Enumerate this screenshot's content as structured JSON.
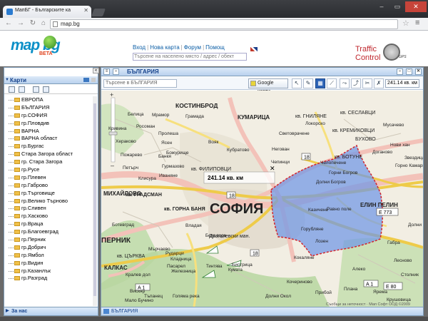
{
  "browser": {
    "tab_title": "МапБГ - Българските ка",
    "url": "map.bg"
  },
  "header": {
    "nav": [
      "Вход",
      "Нова карта",
      "Форум",
      "Помощ"
    ],
    "search_placeholder": "Търсене на населено място / адрес / обект",
    "logo_text": "map bg",
    "logo_beta": "BETA",
    "traffic_line1": "Traffic",
    "traffic_line2": "Control",
    "traffic_gps": "GPS"
  },
  "sidebar": {
    "title": "Карти",
    "items": [
      "ЕВРОПА",
      "БЪЛГАРИЯ",
      "гр.СОФИЯ",
      "гр.Пловдив",
      "ВАРНА",
      "ВАРНА област",
      "гр.Бургас",
      "Стара Загора област",
      "гр. Стара Загора",
      "гр.Русе",
      "гр.Плевен",
      "гр.Габрово",
      "гр.Търговище",
      "гр.Велико Търново",
      "гр.Сливен",
      "гр.Хасково",
      "гр.Враца",
      "гр.Благоевград",
      "гр.Перник",
      "гр.Добрич",
      "гр.Ямбол",
      "гр.Видин",
      "гр.Казанлък",
      "гр.Разград"
    ],
    "footer": "За нас"
  },
  "map_window": {
    "title": "БЪЛГАРИЯ",
    "search_placeholder": "Търсене в БЪЛГАРИЯ",
    "google_button": "Google карти",
    "area_readout": "241.14 кв. км",
    "status_tab": "БЪЛГАРИЯ",
    "copyright": "Съобщи за неточност · Мап Софт ООД ©2009"
  },
  "map": {
    "polygon_label": "241.14 кв. км",
    "city_label": "СОФИЯ",
    "labels": [
      "КОСТИНБРОД",
      "КУМАРИЦА",
      "кв. ГНИЛЯНЕ",
      "кв. СЕСЛАВЦИ",
      "БУХОВО",
      "кв. КРЕМИКОВЦИ",
      "кв. БОТУНЕ",
      "кв. ФИЛИПОВЦИ",
      "МИХАЙЛОВО",
      "кв. ГРАДСМАН",
      "кв. ГОРНА БАНЯ",
      "ЕЛИН ПЕЛИН",
      "ПЕРНИК",
      "КАЛКАС",
      "кв. ЦЪРКВА",
      "Драгалевски ман.",
      "Белица",
      "Вояк",
      "Кубратово",
      "Негован",
      "Световрачене",
      "Чепинци",
      "Челопечене",
      "Локорско",
      "Кривина",
      "Горни Богров",
      "Долни Богров",
      "Казичене",
      "Равно поле",
      "Горубляне",
      "Банкя",
      "Иваняне",
      "Владая",
      "Бистрица",
      "Железница",
      "Кокаляне",
      "Лозен",
      "Пасарел",
      "Мърчаево",
      "Рударци",
      "Кладница",
      "Кралев дол",
      "Вискяр",
      "Мало Бучино",
      "Божурище",
      "Гурмазово",
      "Пролеша",
      "Ясен",
      "Пожарево",
      "Росоман",
      "Хераково",
      "Петърч",
      "Клисура",
      "Мрамор",
      "Грамада",
      "Бела вода",
      "Тинтява",
      "Кумата",
      "Алеко",
      "Ярема",
      "Крушовица",
      "Габра",
      "Горно Камарци",
      "Нови хан",
      "Доганово",
      "Мусачево",
      "Звездица",
      "Лесново",
      "Долни Пасарел",
      "Столник",
      "Плана",
      "Прибой",
      "Кочериново",
      "Долни Окол",
      "Голяма река",
      "Тъпанец",
      "Ботевград"
    ],
    "road_shields": [
      "18",
      "18",
      "18",
      "A 1",
      "A 1",
      "E 773",
      "E 80"
    ]
  },
  "colors": {
    "polygon_fill": "#6f97e6",
    "polygon_stroke": "#d3232b",
    "accent": "#15428b"
  }
}
